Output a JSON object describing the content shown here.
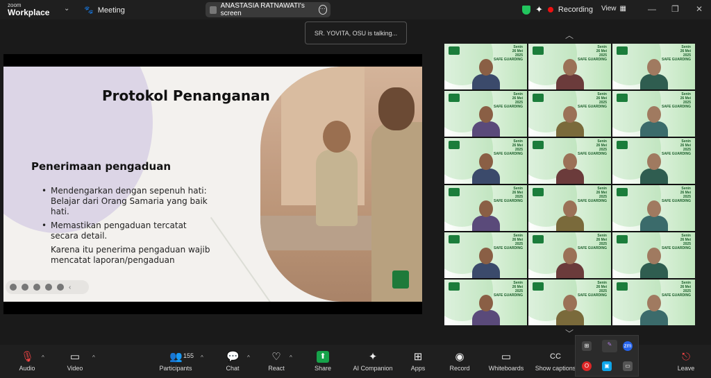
{
  "app": {
    "brand_top": "zoom",
    "brand_main": "Workplace"
  },
  "topbar": {
    "meeting_label": "Meeting",
    "screen_share_label": "ANASTASIA RATNAWATI's screen",
    "recording_label": "Recording",
    "view_label": "View"
  },
  "talking_indicator": "SR. YOVITA, OSU is talking...",
  "slide": {
    "title": "Protokol Penanganan",
    "subtitle": "Penerimaan pengaduan",
    "bullets": [
      "Mendengarkan dengan sepenuh hati: Belajar dari Orang    Samaria  yang baik hati.",
      "Memastikan pengaduan tercatat secara detail.",
      "Karena itu penerima   pengaduan wajib mencatat   laporan/pengaduan"
    ]
  },
  "gallery": {
    "tile_date_line1": "Senin",
    "tile_date_line2": "26 Mei",
    "tile_date_line3": "2025",
    "tile_caption": "SAFE GUARDING",
    "tile_count": 18
  },
  "toolbar": {
    "audio": "Audio",
    "video": "Video",
    "participants": "Participants",
    "participants_count": "155",
    "chat": "Chat",
    "react": "React",
    "share": "Share",
    "ai_companion": "AI Companion",
    "apps": "Apps",
    "record": "Record",
    "whiteboards": "Whiteboards",
    "show_captions": "Show captions",
    "leave": "Leave"
  },
  "colors": {
    "bar": "#1f1f1f",
    "share_green": "#16a34a",
    "shield_green": "#22c55e",
    "slide_bg": "#f3f1ee"
  }
}
